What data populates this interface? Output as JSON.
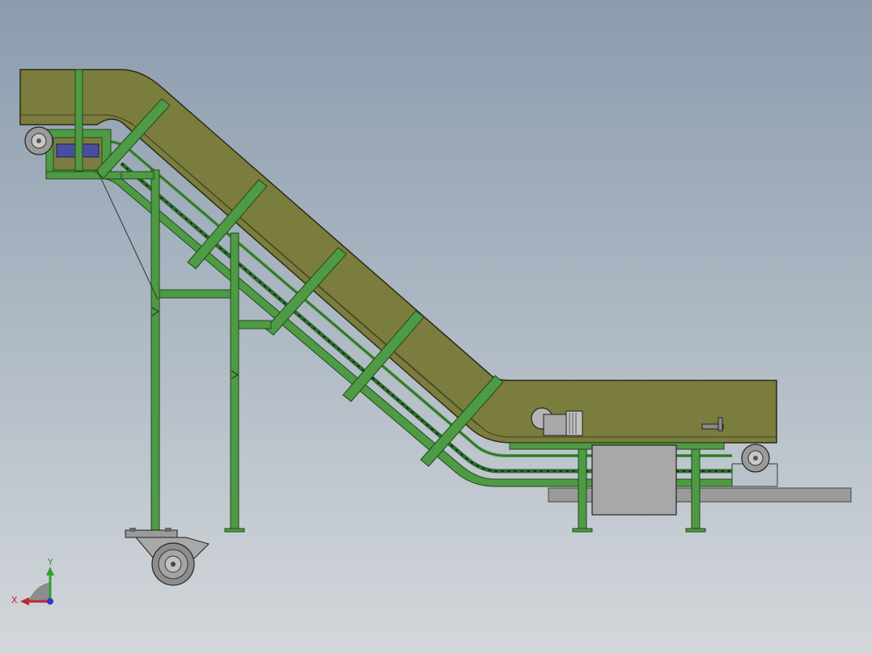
{
  "viewport": {
    "background_top": "#8c9cae",
    "background_bottom": "#d3d7db"
  },
  "model": {
    "housing_color": "#7b7d3e",
    "frame_color": "#4f9a45",
    "frame_dark": "#2f6b2c",
    "motor_color": "#b8b8b8",
    "cabinet_color": "#a8a8a8",
    "base_plate_color": "#9a9a9a"
  },
  "triad": {
    "x_label": "X",
    "y_label": "Y",
    "x_color": "#c0282d",
    "y_color": "#2fa032",
    "z_color": "#2a3cc0"
  }
}
